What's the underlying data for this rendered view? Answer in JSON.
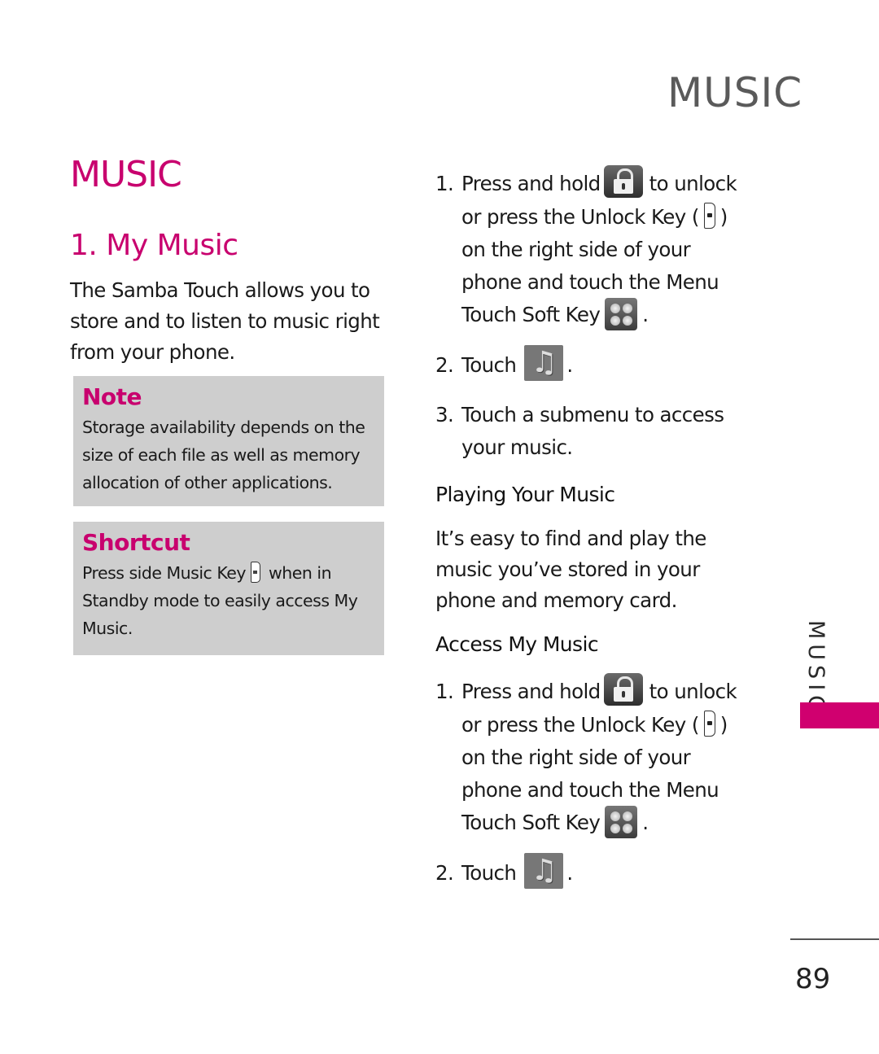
{
  "header": {
    "title": "MUSIC"
  },
  "section": {
    "title": "MUSIC",
    "subtitle": "1. My Music"
  },
  "intro": "The Samba Touch allows you to store and to listen to music right from your phone.",
  "note": {
    "title": "Note",
    "text": "Storage availability depends on the size of each file as well as memory allocation of other applications."
  },
  "shortcut": {
    "title": "Shortcut",
    "text_before": "Press side Music Key",
    "text_after": "when in Standby mode to easily access My Music.",
    "icon": "music-key-icon"
  },
  "steps_top": {
    "step1": {
      "num": "1.",
      "line1_a": "Press and hold",
      "line1_b": "to unlock",
      "line2_a": "or press the Unlock Key (",
      "line2_b": ")",
      "line3": "on the right side of your",
      "line4": "phone and touch the Menu",
      "line5_a": "Touch Soft Key",
      "line5_b": "."
    },
    "step2": {
      "num": "2.",
      "text": "Touch",
      "end": "."
    },
    "step3": {
      "num": "3.",
      "line1": "Touch a submenu to access",
      "line2": "your music."
    }
  },
  "playing": {
    "heading": "Playing Your Music",
    "text": "It’s easy to find and play the music you’ve stored in your phone and memory card."
  },
  "access": {
    "heading": "Access My Music",
    "step1": {
      "num": "1.",
      "line1_a": "Press and hold",
      "line1_b": "to unlock",
      "line2_a": "or press the Unlock Key (",
      "line2_b": ")",
      "line3": "on the right side of your",
      "line4": "phone and touch the Menu",
      "line5_a": "Touch Soft Key",
      "line5_b": "."
    },
    "step2": {
      "num": "2.",
      "text": "Touch",
      "end": "."
    }
  },
  "side_tab": {
    "label": "MUSIC",
    "color": "#d0006f"
  },
  "footer": {
    "page_number": "89"
  },
  "colors": {
    "accent": "#c8006e",
    "box_bg": "#cecece",
    "header_gray": "#5a5a5a"
  }
}
